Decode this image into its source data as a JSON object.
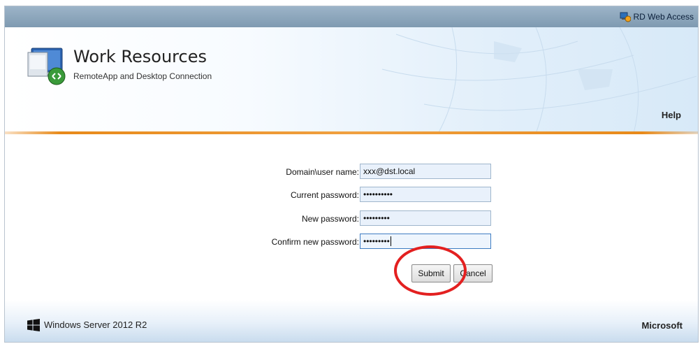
{
  "topbar": {
    "link_label": "RD Web Access"
  },
  "header": {
    "title": "Work Resources",
    "subtitle": "RemoteApp and Desktop Connection",
    "help_label": "Help"
  },
  "form": {
    "fields": [
      {
        "label": "Domain\\user name:",
        "value": "xxx@dst.local"
      },
      {
        "label": "Current password:",
        "value": "••••••••••"
      },
      {
        "label": "New password:",
        "value": "•••••••••"
      },
      {
        "label": "Confirm new password:",
        "value": "•••••••••"
      }
    ],
    "submit_label": "Submit",
    "cancel_label": "Cancel"
  },
  "footer": {
    "product": "Windows Server 2012 R2",
    "vendor": "Microsoft"
  },
  "colors": {
    "accent_orange": "#e88a1a",
    "annotation_red": "#e32020",
    "topbar": "#8ca6bc"
  }
}
